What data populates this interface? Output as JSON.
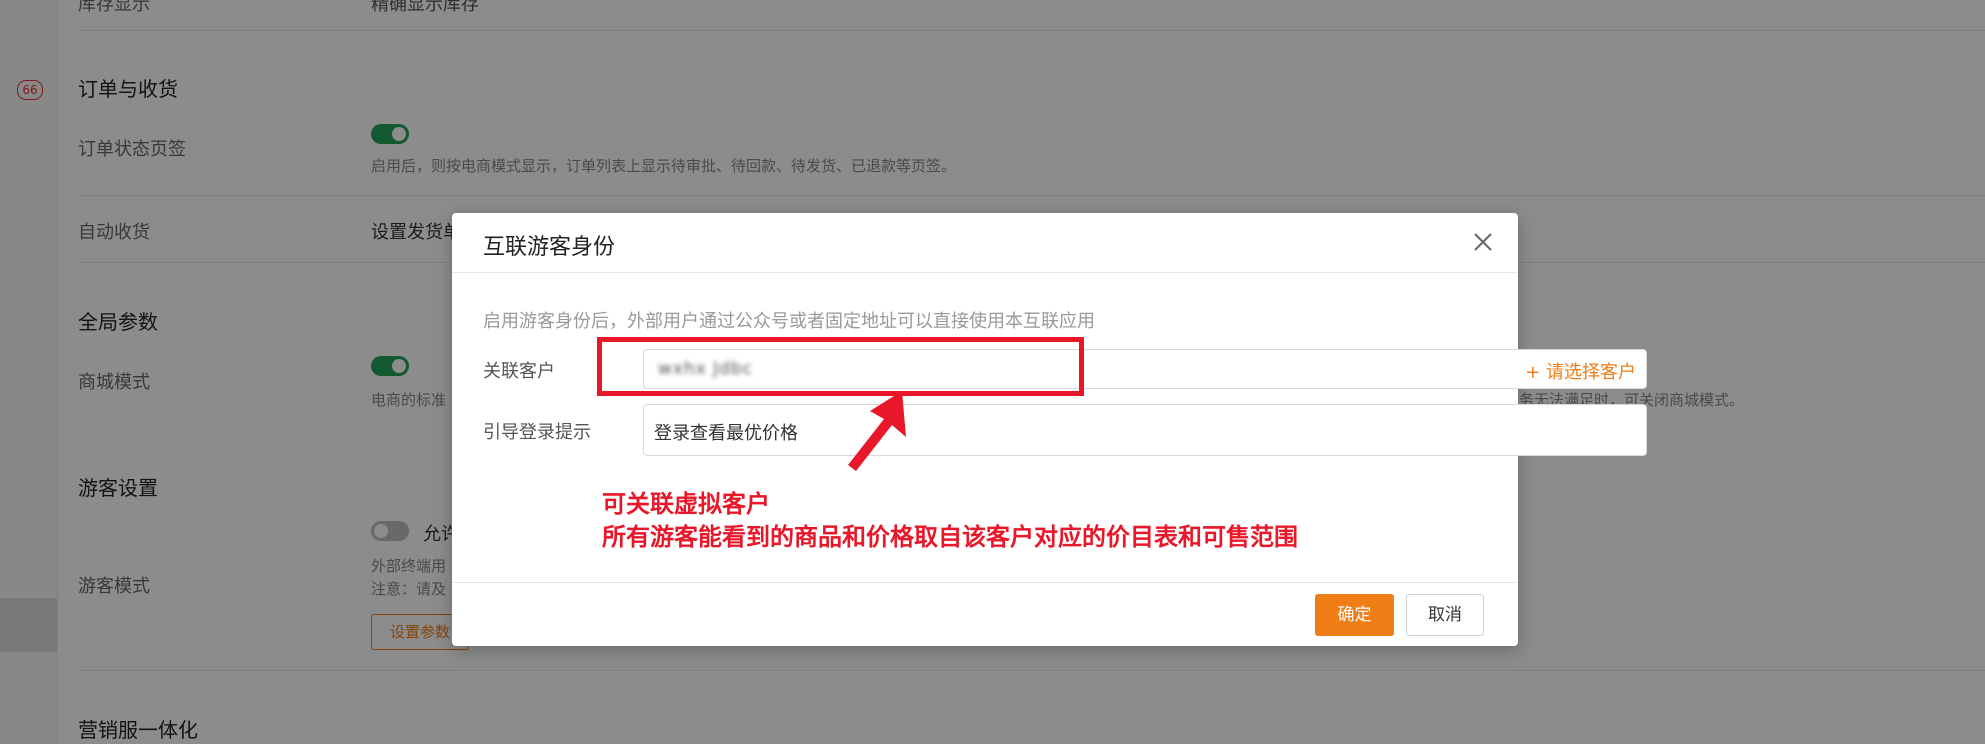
{
  "background": {
    "top_cut_text": "库存显示",
    "top_cut_value": "精确显示库存",
    "rail_badge": "66",
    "sections": {
      "orders": {
        "title": "订单与收货",
        "status_tabs_label": "订单状态页签",
        "status_tabs_desc": "启用后，则按电商模式显示，订单列表上显示待审批、待回款、待发货、已退款等页签。",
        "auto_receive_label": "自动收货",
        "auto_receive_text": "设置发货单"
      },
      "global": {
        "title": "全局参数",
        "mall_mode_label": "商城模式",
        "mall_mode_desc_left": "电商的标准",
        "mall_mode_desc_right": "务无法满足时，可关闭商城模式。"
      },
      "guest": {
        "title": "游客设置",
        "mode_label": "游客模式",
        "allow_option": "允许",
        "desc_line1": "外部终端用",
        "desc_line2": "注意：请及",
        "settings_button": "设置参数"
      },
      "marketing": {
        "title": "营销服一体化"
      }
    }
  },
  "modal": {
    "title": "互联游客身份",
    "hint": "启用游客身份后，外部用户通过公众号或者固定地址可以直接使用本互联应用",
    "customer_label": "关联客户",
    "customer_value": "wxhx Jdbc",
    "select_customer_link": "+ 请选择客户",
    "login_prompt_label": "引导登录提示",
    "login_prompt_value": "登录查看最优价格",
    "ok_button": "确定",
    "cancel_button": "取消"
  },
  "annotation": {
    "line1": "可关联虚拟客户",
    "line2": "所有游客能看到的商品和价格取自该客户对应的价目表和可售范围",
    "color": "#e8172a"
  },
  "colors": {
    "accent": "#f07e16",
    "toggle_on": "#22a35a"
  }
}
